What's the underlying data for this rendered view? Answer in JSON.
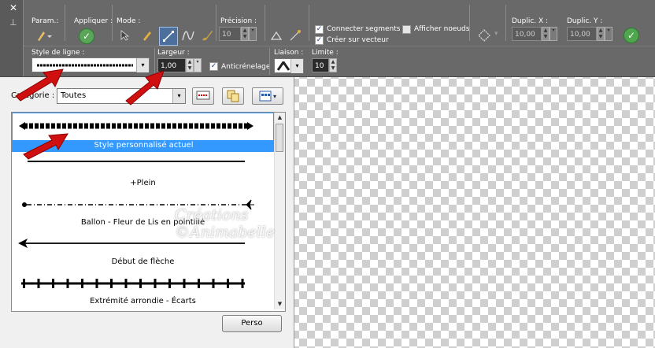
{
  "toolbar": {
    "groups": {
      "param": "Param.:",
      "appliquer": "Appliquer :",
      "mode": "Mode :",
      "precision": "Précision :",
      "duplic_x": "Duplic. X :",
      "duplic_y": "Duplic. Y :"
    },
    "precision_value": "10",
    "duplic_x_value": "10,00",
    "duplic_y_value": "10,00",
    "connecter_segments": "Connecter segments",
    "afficher_noeuds": "Afficher noeuds",
    "creer_sur_vecteur": "Créer sur vecteur",
    "style_de_ligne": "Style de ligne :",
    "largeur": "Largeur :",
    "largeur_value": "1,00",
    "anticrenelage": "Anticrénelage",
    "liaison": "Liaison :",
    "limite": "Limite :",
    "limite_value": "10",
    "icons": [
      "close-icon",
      "pin-icon",
      "pen-tool-icon",
      "apply-check-icon",
      "arrow-select-icon",
      "pencil-icon",
      "line-segment-icon",
      "bezier-icon",
      "brush-icon",
      "angle-icon",
      "node-edit-icon",
      "duplicate-nodes-icon",
      "ok-icon"
    ],
    "accent": "#4fa64f"
  },
  "dialog": {
    "categorie_label": "Catégorie :",
    "categorie_value": "Toutes",
    "items": [
      "Style personnalisé actuel",
      "+Plein",
      "Ballon - Fleur de Lis en pointillé",
      "Début de flèche",
      "Extrémité arrondie - Écarts"
    ],
    "perso_label": "Perso",
    "selection_color": "#3399ff"
  },
  "watermark": {
    "line1": "Créations",
    "line2": "©Animabelle"
  },
  "annotation_color": "#d01010"
}
